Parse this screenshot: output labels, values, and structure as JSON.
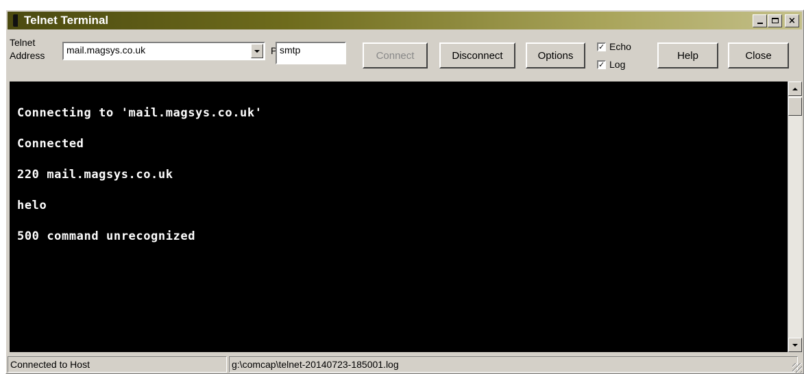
{
  "window": {
    "title": "Telnet Terminal",
    "controls": {
      "minimize": "minimize-icon",
      "maximize": "maximize-icon",
      "close": "close-icon",
      "close_glyph": "×"
    }
  },
  "toolbar": {
    "address_label_line1": "Telnet",
    "address_label_line2": "Address",
    "address_value": "mail.magsys.co.uk",
    "port_label": "Port",
    "port_value": "smtp",
    "connect_label": "Connect",
    "disconnect_label": "Disconnect",
    "options_label": "Options",
    "echo_label": "Echo",
    "echo_checked": true,
    "log_label": "Log",
    "log_checked": true,
    "help_label": "Help",
    "close_label": "Close"
  },
  "terminal": {
    "background": "#000000",
    "foreground": "#ffffff",
    "lines": [
      "Connecting to 'mail.magsys.co.uk'",
      "Connected",
      "220 mail.magsys.co.uk",
      "helo",
      "500 command unrecognized"
    ]
  },
  "statusbar": {
    "connection_status": "Connected to Host",
    "log_file": "g:\\comcap\\telnet-20140723-185001.log"
  },
  "colors": {
    "title_gradient_start": "#4b4a10",
    "title_gradient_end": "#c4c08a",
    "face": "#d4d0c8"
  }
}
